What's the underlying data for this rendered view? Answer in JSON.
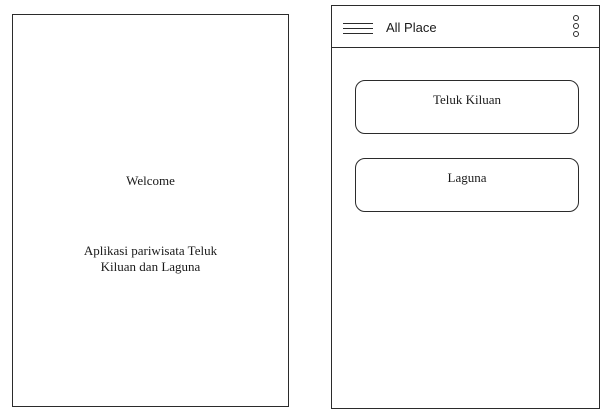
{
  "splash": {
    "welcome_text": "Welcome",
    "description_lines": [
      "Aplikasi pariwisata Teluk",
      "Kiluan dan Laguna"
    ]
  },
  "place_list": {
    "title": "All Place",
    "menu_icon": "hamburger-icon",
    "overflow_icon": "vertical-dots-icon",
    "items": [
      {
        "label": "Teluk Kiluan"
      },
      {
        "label": "Laguna"
      }
    ]
  }
}
